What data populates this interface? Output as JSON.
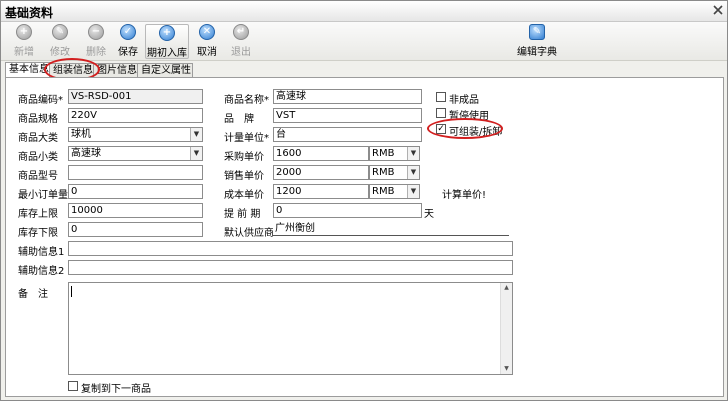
{
  "window": {
    "title": "基础资料"
  },
  "toolbar": {
    "new": "新增",
    "edit": "修改",
    "delete": "删除",
    "save": "保存",
    "opening_stock": "期初入库",
    "cancel": "取消",
    "exit": "退出",
    "edit_dictionary": "编辑字典"
  },
  "tabs": [
    "基本信息",
    "组装信息",
    "图片信息",
    "自定义属性"
  ],
  "form": {
    "code_label": "商品编码*",
    "code_value": "VS-RSD-001",
    "name_label": "商品名称*",
    "name_value": "高速球",
    "spec_label": "商品规格",
    "spec_value": "220V",
    "brand_label": "品　牌",
    "brand_value": "VST",
    "category_label": "商品大类",
    "category_value": "球机",
    "unit_label": "计量单位*",
    "unit_value": "台",
    "subcategory_label": "商品小类",
    "subcategory_value": "高速球",
    "purchase_price_label": "采购单价",
    "purchase_price_value": "1600",
    "purchase_currency": "RMB",
    "model_label": "商品型号",
    "model_value": "",
    "sale_price_label": "销售单价",
    "sale_price_value": "2000",
    "sale_currency": "RMB",
    "min_order_label": "最小订单量",
    "min_order_value": "0",
    "cost_price_label": "成本单价",
    "cost_price_value": "1200",
    "cost_currency": "RMB",
    "calc_price": "计算单价!",
    "stock_max_label": "库存上限",
    "stock_max_value": "10000",
    "lead_time_label": "提 前 期",
    "lead_time_value": "0",
    "lead_time_unit": "天",
    "stock_min_label": "库存下限",
    "stock_min_value": "0",
    "default_supplier_label": "默认供应商",
    "default_supplier_value": "广州衡创",
    "aux1_label": "辅助信息1",
    "aux1_value": "",
    "aux2_label": "辅助信息2",
    "aux2_value": "",
    "remark_label": "备　注",
    "remark_value": ""
  },
  "options": {
    "semi_finished": {
      "label": "非成品",
      "checked": false
    },
    "suspended": {
      "label": "暂停使用",
      "checked": false
    },
    "assemblable": {
      "label": "可组装/拆卸",
      "checked": true
    }
  },
  "copy_next": {
    "label": "复制到下一商品",
    "checked": false
  },
  "colors": {
    "highlight_ring": "#d21f1f",
    "accent_blue": "#2f7cd0"
  }
}
